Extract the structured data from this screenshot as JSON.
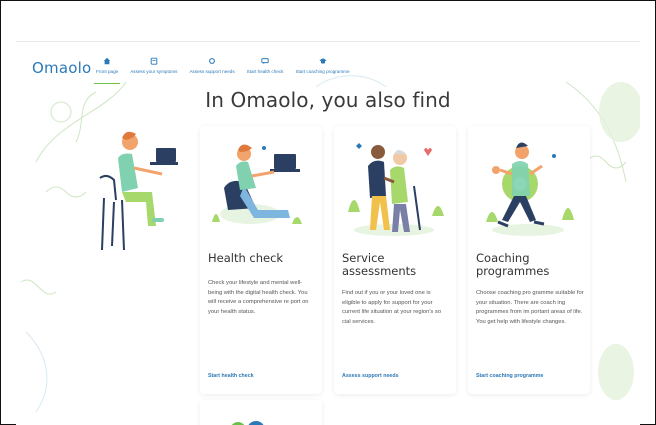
{
  "app": {
    "logo": "Omaolo"
  },
  "nav": {
    "items": [
      {
        "label": "Front page",
        "icon": "home-icon",
        "active": true
      },
      {
        "label": "Assess your symptoms",
        "icon": "clipboard-icon",
        "active": false
      },
      {
        "label": "Assess support needs",
        "icon": "support-icon",
        "active": false
      },
      {
        "label": "Start health check",
        "icon": "chat-icon",
        "active": false
      },
      {
        "label": "Start coaching programme",
        "icon": "graduation-icon",
        "active": false
      }
    ]
  },
  "main": {
    "headline": "In Omaolo, you also find",
    "cards": [
      {
        "title": "Health check",
        "text": "Check your lifestyle and mental well-being with the digital health check. You will receive a comprehensive re port on your health status.",
        "link": "Start health check"
      },
      {
        "title": "Service assessments",
        "text": "Find out if you or your loved one is eligible to apply for support for your current life situation at your region's so cial services.",
        "link": "Assess support needs"
      },
      {
        "title": "Coaching programmes",
        "text": "Choose coaching pro gramme suitable for your situation. There are coach ing programmes from im portant areas of life. You get help with lifestyle changes.",
        "link": "Start coaching programme"
      }
    ]
  },
  "colors": {
    "brand": "#2c79b8",
    "accent": "#6cc04a",
    "deco": "#cfe6c4"
  }
}
